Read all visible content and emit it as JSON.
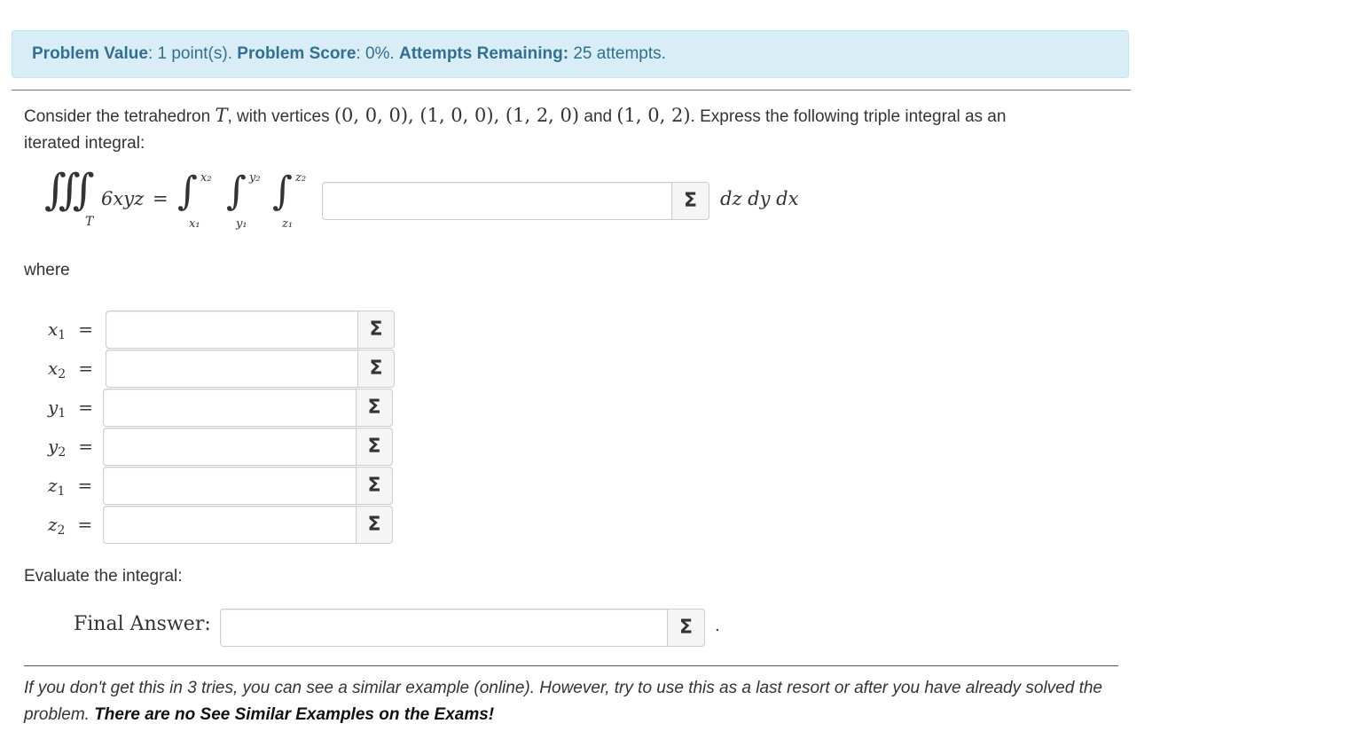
{
  "status": {
    "value_label": "Problem Value",
    "value_text": ": 1 point(s).",
    "score_label": "Problem Score",
    "score_text": ": 0%.",
    "attempts_label": "Attempts Remaining:",
    "attempts_text": " 25 attempts."
  },
  "problem": {
    "intro_1": "Consider the tetrahedron ",
    "tetra_symbol": "T",
    "intro_2": ", with vertices ",
    "v1": "(0, 0, 0)",
    "v2": "(1, 0, 0)",
    "v3": "(1, 2, 0)",
    "and_word": " and ",
    "v4": "(1, 0, 2)",
    "intro_3": ". Express the following triple integral as an",
    "intro_line2": "iterated integral:",
    "triple_integral_symbol": "∭",
    "region_subscript": "T",
    "integrand": "6xyz",
    "equals": "=",
    "integral_symbol": "∫",
    "limits": {
      "outer_upper": "x₂",
      "outer_lower": "x₁",
      "middle_upper": "y₂",
      "middle_lower": "y₁",
      "inner_upper": "z₂",
      "inner_lower": "z₁"
    },
    "differentials": "dz dy dx",
    "where_text": "where",
    "evaluate_text": "Evaluate the integral:",
    "final_answer_label": "Final Answer:",
    "period": "."
  },
  "sigma_symbol": "Σ",
  "limit_fields": [
    {
      "var": "x",
      "sub": "1",
      "eq": "=",
      "value": ""
    },
    {
      "var": "x",
      "sub": "2",
      "eq": "=",
      "value": ""
    },
    {
      "var": "y",
      "sub": "1",
      "eq": "=",
      "value": ""
    },
    {
      "var": "y",
      "sub": "2",
      "eq": "=",
      "value": ""
    },
    {
      "var": "z",
      "sub": "1",
      "eq": "=",
      "value": ""
    },
    {
      "var": "z",
      "sub": "2",
      "eq": "=",
      "value": ""
    }
  ],
  "integrand_field": {
    "value": ""
  },
  "final_answer_field": {
    "value": ""
  },
  "footer": {
    "note_italic": "If you don't get this in 3 tries, you can see a similar example (online). However, try to use this as a last resort or after you have already solved the problem. ",
    "note_bold": "There are no See Similar Examples on the Exams!"
  }
}
